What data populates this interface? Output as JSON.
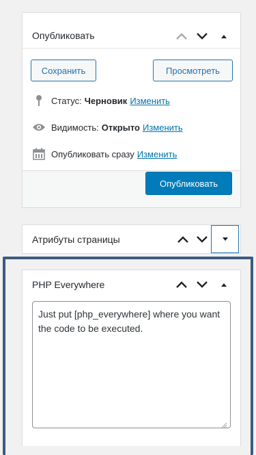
{
  "publish_box": {
    "title": "Опубликовать",
    "save_label": "Сохранить",
    "preview_label": "Просмотреть",
    "status": {
      "label": "Статус:",
      "value": "Черновик",
      "edit": "Изменить"
    },
    "visibility": {
      "label": "Видимость:",
      "value": "Открыто",
      "edit": "Изменить"
    },
    "schedule": {
      "label": "Опубликовать сразу",
      "edit": "Изменить"
    },
    "publish_label": "Опубликовать"
  },
  "attributes_box": {
    "title": "Атрибуты страницы"
  },
  "php_box": {
    "title": "PHP Everywhere",
    "textarea_value": "Just put [php_everywhere] where you want the code to be executed."
  },
  "colors": {
    "accent": "#007cba",
    "link": "#0073aa",
    "highlight_border": "#3d5a80",
    "background": "#f1f1f1"
  },
  "icons": [
    "chevron-up-icon",
    "chevron-down-icon",
    "triangle-up-icon",
    "triangle-down-icon",
    "pin-icon",
    "eye-icon",
    "calendar-icon"
  ]
}
